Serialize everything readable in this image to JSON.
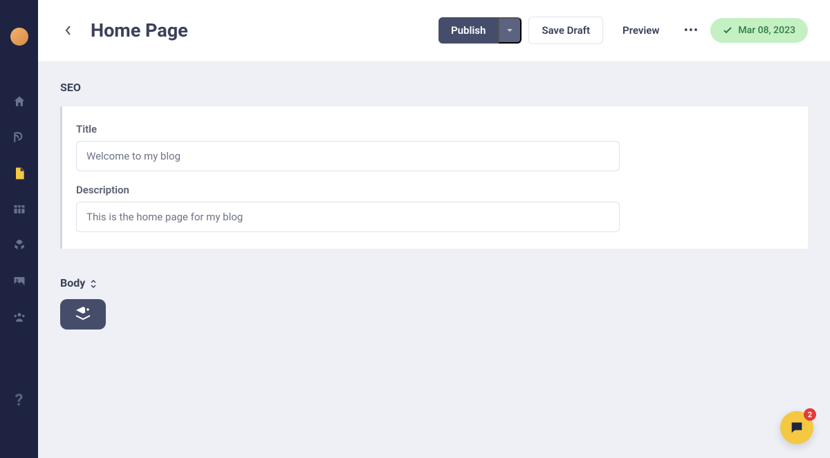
{
  "header": {
    "title": "Home Page",
    "publish_label": "Publish",
    "save_draft_label": "Save Draft",
    "preview_label": "Preview",
    "status_date": "Mar 08, 2023"
  },
  "seo": {
    "section_label": "SEO",
    "title_label": "Title",
    "title_value": "Welcome to my blog",
    "description_label": "Description",
    "description_value": "This is the home page for my blog"
  },
  "body": {
    "section_label": "Body"
  },
  "help": {
    "badge_count": "2"
  }
}
